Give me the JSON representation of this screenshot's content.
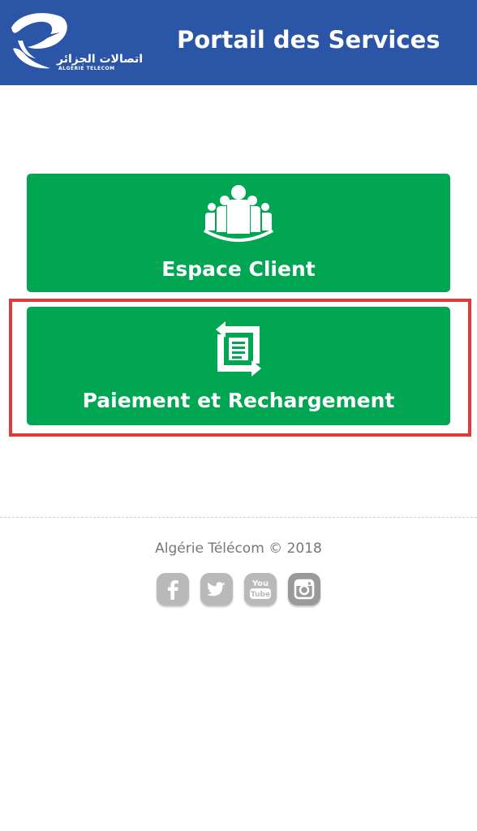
{
  "header": {
    "logo_arabic": "اتصالات الجزائر",
    "logo_latin": "ALGERIE TELECOM",
    "title": "Portail des Services",
    "background": "#2b55a7"
  },
  "services": [
    {
      "label": "Espace Client",
      "icon": "users-group-icon"
    },
    {
      "label": "Paiement et Rechargement",
      "icon": "document-exchange-icon"
    }
  ],
  "colors": {
    "button": "#00a651",
    "highlight": "#e03b3b",
    "footer_text": "#777777"
  },
  "footer": {
    "copyright": "Algérie Télécom © 2018",
    "social": [
      {
        "name": "facebook-icon"
      },
      {
        "name": "twitter-icon"
      },
      {
        "name": "youtube-icon",
        "text": "You Tube"
      },
      {
        "name": "instagram-icon"
      }
    ]
  }
}
